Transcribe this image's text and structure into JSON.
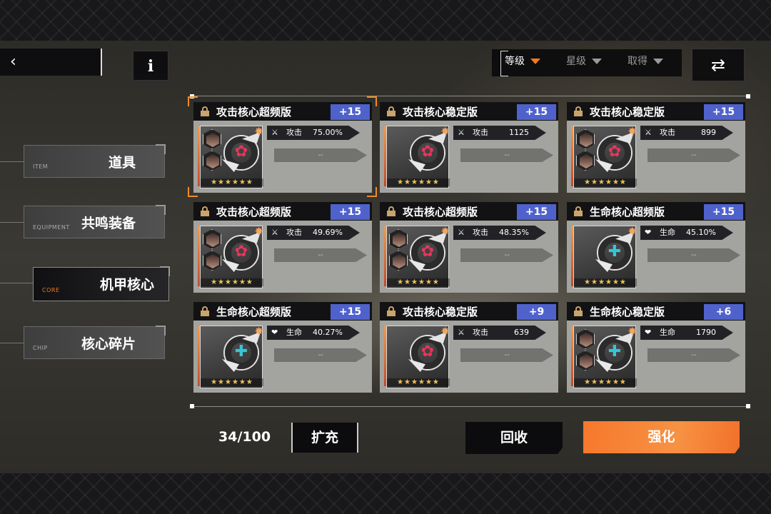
{
  "sort": {
    "options": [
      {
        "label": "等级",
        "active": true
      },
      {
        "label": "星级",
        "active": false
      },
      {
        "label": "取得",
        "active": false
      }
    ],
    "swap_icon": "swap-arrows-icon",
    "info_label": "i"
  },
  "categories": [
    {
      "en": "ITEM",
      "zh": "道具",
      "active": false
    },
    {
      "en": "EQUIPMENT",
      "zh": "共鸣装备",
      "active": false
    },
    {
      "en": "CORE",
      "zh": "机甲核心",
      "active": true
    },
    {
      "en": "CHIP",
      "zh": "核心碎片",
      "active": false
    }
  ],
  "cards": [
    {
      "name": "攻击核心超频版",
      "level": "+15",
      "stat_key": "攻击",
      "stat_value": "75.00%",
      "sub": "--",
      "type": "attack",
      "stars": 6,
      "selected": true
    },
    {
      "name": "攻击核心稳定版",
      "level": "+15",
      "stat_key": "攻击",
      "stat_value": "1125",
      "sub": "--",
      "type": "attack",
      "stars": 6,
      "selected": false
    },
    {
      "name": "攻击核心稳定版",
      "level": "+15",
      "stat_key": "攻击",
      "stat_value": "899",
      "sub": "--",
      "type": "attack",
      "stars": 6,
      "selected": false
    },
    {
      "name": "攻击核心超频版",
      "level": "+15",
      "stat_key": "攻击",
      "stat_value": "49.69%",
      "sub": "--",
      "type": "attack",
      "stars": 6,
      "selected": false
    },
    {
      "name": "攻击核心超频版",
      "level": "+15",
      "stat_key": "攻击",
      "stat_value": "48.35%",
      "sub": "--",
      "type": "attack",
      "stars": 6,
      "selected": false
    },
    {
      "name": "生命核心超频版",
      "level": "+15",
      "stat_key": "生命",
      "stat_value": "45.10%",
      "sub": "--",
      "type": "life",
      "stars": 6,
      "selected": false
    },
    {
      "name": "生命核心超频版",
      "level": "+15",
      "stat_key": "生命",
      "stat_value": "40.27%",
      "sub": "--",
      "type": "life",
      "stars": 6,
      "selected": false
    },
    {
      "name": "攻击核心稳定版",
      "level": "+9",
      "stat_key": "攻击",
      "stat_value": "639",
      "sub": "--",
      "type": "attack",
      "stars": 6,
      "selected": false
    },
    {
      "name": "生命核心稳定版",
      "level": "+6",
      "stat_key": "生命",
      "stat_value": "1790",
      "sub": "--",
      "type": "life",
      "stars": 6,
      "selected": false
    }
  ],
  "footer": {
    "count": "34/100",
    "expand_label": "扩充",
    "recycle_label": "回收",
    "enhance_label": "强化"
  },
  "colors": {
    "accent_orange": "#f07a20",
    "level_blue": "#4f62cc",
    "enhance_orange": "#f6772c"
  }
}
